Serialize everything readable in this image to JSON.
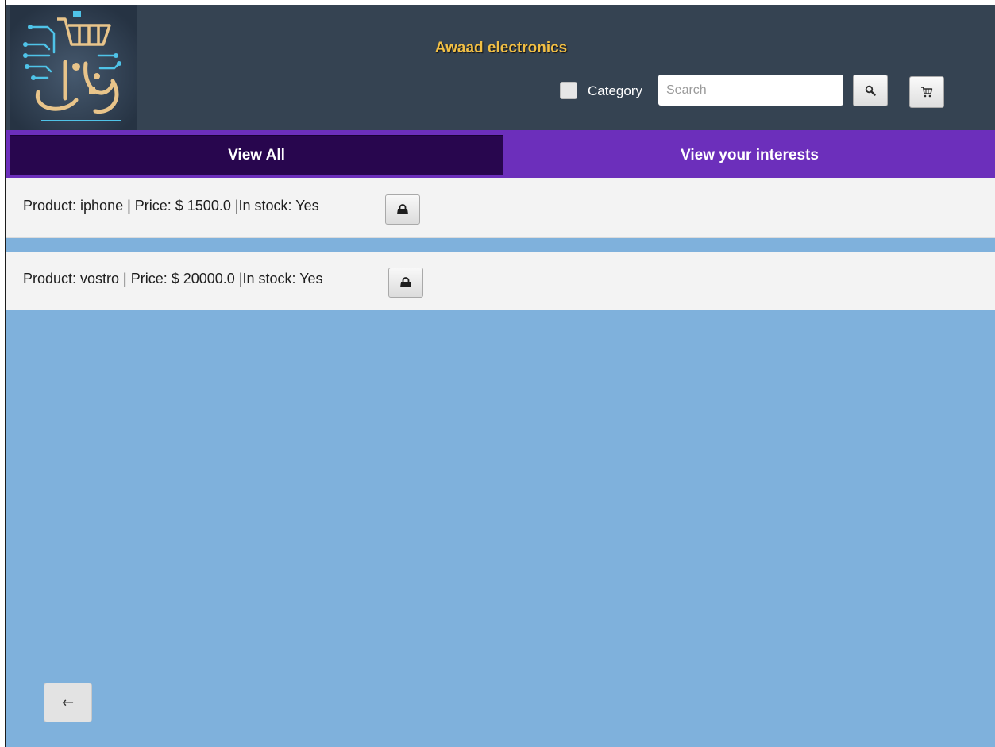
{
  "header": {
    "logo_name": "circuit-cart-logo",
    "store_title": "Awaad electronics",
    "category_label": "Category",
    "category_checked": false,
    "search_placeholder": "Search",
    "search_value": ""
  },
  "tabs": [
    {
      "label": "View All",
      "active": true
    },
    {
      "label": "View your interests",
      "active": false
    }
  ],
  "products": [
    {
      "text": "Product: iphone | Price: $ 1500.0 |In stock: Yes",
      "action_icon": "bag-icon"
    },
    {
      "text": "Product: vostro | Price: $ 20000.0 |In stock: Yes",
      "action_icon": "bag-icon"
    }
  ],
  "back_button": {
    "glyph": "←"
  },
  "colors": {
    "header_bg": "#354352",
    "title": "#f1bf45",
    "tab_active": "#28064e",
    "tab_inactive": "#6c2fbb",
    "content_bg": "#7fb1dc"
  }
}
